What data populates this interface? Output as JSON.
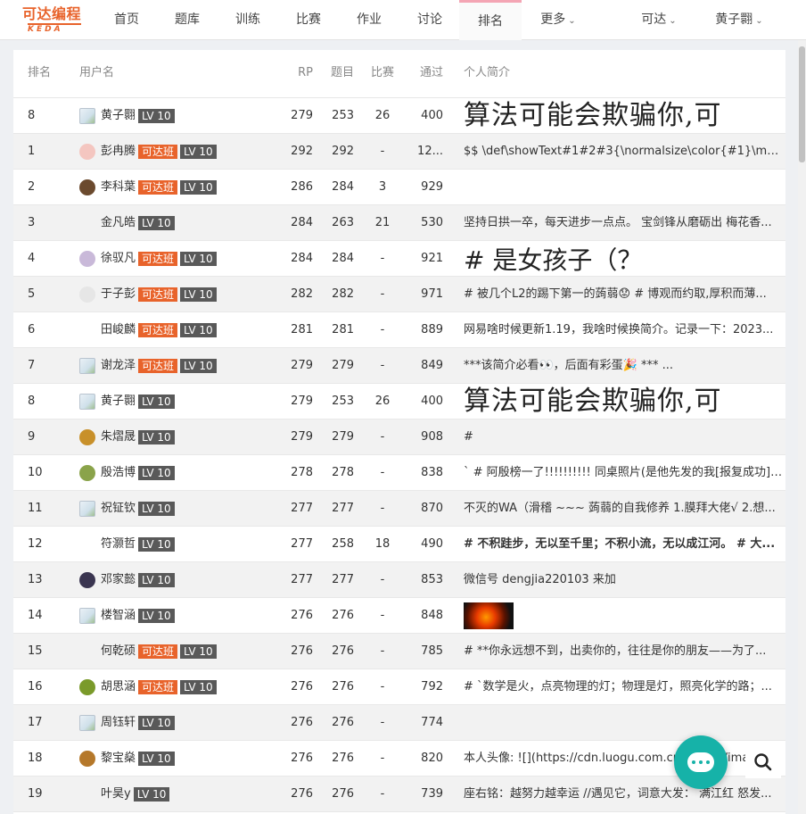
{
  "brand": {
    "name": "可达编程",
    "sub": "KEDA",
    "color": "#e8632b"
  },
  "nav": {
    "items": [
      "首页",
      "题库",
      "训练",
      "比赛",
      "作业",
      "讨论",
      "排名"
    ],
    "more": "更多",
    "active": "排名",
    "org": "可达",
    "user": "黄子翾"
  },
  "table": {
    "headers": {
      "rank": "排名",
      "user": "用户名",
      "rp": "RP",
      "problems": "题目",
      "contests": "比赛",
      "accepted": "通过",
      "bio": "个人简介"
    },
    "rows": [
      {
        "rank": "8",
        "name": "黄子翾",
        "kd": "",
        "lv": "LV 10",
        "rp": "279",
        "problems": "253",
        "contests": "26",
        "accepted": "400",
        "bio": "算法可能会欺骗你,可",
        "avatar": "broken",
        "bio_style": "big"
      },
      {
        "rank": "1",
        "name": "彭冉腾",
        "kd": "可达班",
        "lv": "LV 10",
        "rp": "292",
        "problems": "292",
        "contests": "-",
        "accepted": "12...",
        "bio": "$$ \\def\\showText#1#2#3{\\normalsize\\color{#1}\\math...",
        "avatar": "#f4c6c0",
        "bio_style": "normal"
      },
      {
        "rank": "2",
        "name": "李科葉",
        "kd": "可达班",
        "lv": "LV 10",
        "rp": "286",
        "problems": "284",
        "contests": "3",
        "accepted": "929",
        "bio": "",
        "avatar": "#6b4a2e",
        "bio_style": "normal"
      },
      {
        "rank": "3",
        "name": "金凡皓",
        "kd": "",
        "lv": "LV 10",
        "rp": "284",
        "problems": "263",
        "contests": "21",
        "accepted": "530",
        "bio": "坚持日拱一卒，每天进步一点点。 宝剑锋从磨砺出 梅花香...",
        "avatar": "none",
        "bio_style": "normal"
      },
      {
        "rank": "4",
        "name": "徐驭凡",
        "kd": "可达班",
        "lv": "LV 10",
        "rp": "284",
        "problems": "284",
        "contests": "-",
        "accepted": "921",
        "bio": "# 是女孩子（？",
        "avatar": "#c9b9d9",
        "bio_style": "mid"
      },
      {
        "rank": "5",
        "name": "于子彭",
        "kd": "可达班",
        "lv": "LV 10",
        "rp": "282",
        "problems": "282",
        "contests": "-",
        "accepted": "971",
        "bio": "# 被几个L2的踢下第一的蒟蒻😟 # 博观而约取,厚积而薄...",
        "avatar": "#e6e6e6",
        "bio_style": "normal"
      },
      {
        "rank": "6",
        "name": "田峻麟",
        "kd": "可达班",
        "lv": "LV 10",
        "rp": "281",
        "problems": "281",
        "contests": "-",
        "accepted": "889",
        "bio": "网易啥时候更新1.19，我啥时候换简介。记录一下：2023...",
        "avatar": "none",
        "bio_style": "normal"
      },
      {
        "rank": "7",
        "name": "谢龙泽",
        "kd": "可达班",
        "lv": "LV 10",
        "rp": "279",
        "problems": "279",
        "contests": "-",
        "accepted": "849",
        "bio": "***该简介必看👀，后面有彩蛋🎉 *** ...",
        "avatar": "broken",
        "bio_style": "normal"
      },
      {
        "rank": "8",
        "name": "黄子翾",
        "kd": "",
        "lv": "LV 10",
        "rp": "279",
        "problems": "253",
        "contests": "26",
        "accepted": "400",
        "bio": "算法可能会欺骗你,可",
        "avatar": "broken",
        "bio_style": "big"
      },
      {
        "rank": "9",
        "name": "朱熠晟",
        "kd": "",
        "lv": "LV 10",
        "rp": "279",
        "problems": "279",
        "contests": "-",
        "accepted": "908",
        "bio": "#",
        "avatar": "#c8902a",
        "bio_style": "normal"
      },
      {
        "rank": "10",
        "name": "殷浩博",
        "kd": "",
        "lv": "LV 10",
        "rp": "278",
        "problems": "278",
        "contests": "-",
        "accepted": "838",
        "bio": "` # 阿殷榜一了!!!!!!!!!! 同桌照片(是他先发的我[报复成功]):...",
        "avatar": "#8aa34a",
        "bio_style": "normal"
      },
      {
        "rank": "11",
        "name": "祝钲钦",
        "kd": "",
        "lv": "LV 10",
        "rp": "277",
        "problems": "277",
        "contests": "-",
        "accepted": "870",
        "bio": "不灭的WA（滑稽 ~~~ 蒟蒻的自我修养 1.膜拜大佬√ 2.想...",
        "avatar": "broken",
        "bio_style": "normal"
      },
      {
        "rank": "12",
        "name": "符灏哲",
        "kd": "",
        "lv": "LV 10",
        "rp": "277",
        "problems": "258",
        "contests": "18",
        "accepted": "490",
        "bio": "# 不积跬步，无以至千里；不积小流，无以成江河。 # 大...",
        "avatar": "none",
        "bio_style": "bold"
      },
      {
        "rank": "13",
        "name": "邓家懿",
        "kd": "",
        "lv": "LV 10",
        "rp": "277",
        "problems": "277",
        "contests": "-",
        "accepted": "853",
        "bio": "微信号 dengjia220103 来加",
        "avatar": "#3a3550",
        "bio_style": "normal"
      },
      {
        "rank": "14",
        "name": "楼智涵",
        "kd": "",
        "lv": "LV 10",
        "rp": "276",
        "problems": "276",
        "contests": "-",
        "accepted": "848",
        "bio": "",
        "avatar": "broken",
        "bio_style": "image"
      },
      {
        "rank": "15",
        "name": "何乾硕",
        "kd": "可达班",
        "lv": "LV 10",
        "rp": "276",
        "problems": "276",
        "contests": "-",
        "accepted": "785",
        "bio": "# **你永远想不到，出卖你的，往往是你的朋友——为了...",
        "avatar": "none",
        "bio_style": "normal"
      },
      {
        "rank": "16",
        "name": "胡思涵",
        "kd": "可达班",
        "lv": "LV 10",
        "rp": "276",
        "problems": "276",
        "contests": "-",
        "accepted": "792",
        "bio": "# `数学是火，点亮物理的灯；物理是灯，照亮化学的路；...",
        "avatar": "#7a9a2a",
        "bio_style": "normal"
      },
      {
        "rank": "17",
        "name": "周钰轩",
        "kd": "",
        "lv": "LV 10",
        "rp": "276",
        "problems": "276",
        "contests": "-",
        "accepted": "774",
        "bio": "",
        "avatar": "broken",
        "bio_style": "normal"
      },
      {
        "rank": "18",
        "name": "黎宝燊",
        "kd": "",
        "lv": "LV 10",
        "rp": "276",
        "problems": "276",
        "contests": "-",
        "accepted": "820",
        "bio": "本人头像: ![](https://cdn.luogu.com.cn/upload/imag",
        "avatar": "#b5782a",
        "bio_style": "normal"
      },
      {
        "rank": "19",
        "name": "叶昊y",
        "kd": "",
        "lv": "LV 10",
        "rp": "276",
        "problems": "276",
        "contests": "-",
        "accepted": "739",
        "bio": "座右铭：越努力越幸运 //遇见它，词意大发： 满江红 怒发...",
        "avatar": "none",
        "bio_style": "normal"
      }
    ]
  },
  "float": {
    "chat_icon": "chat-bubble-icon",
    "search_icon": "search-icon"
  }
}
